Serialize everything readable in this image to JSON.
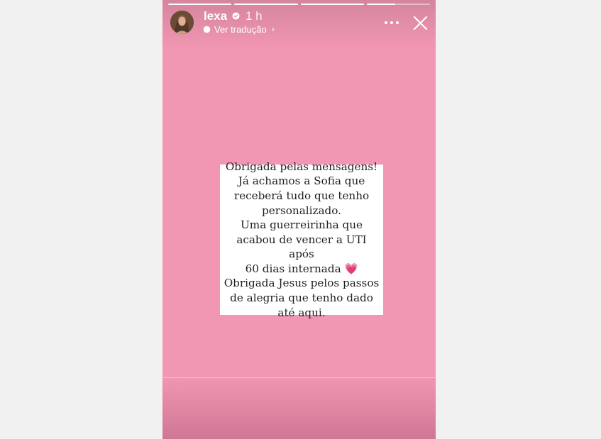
{
  "story": {
    "background_color": "#f297b3",
    "progress": [
      1,
      1,
      1,
      0.45
    ],
    "header": {
      "username": "lexa",
      "verified_icon": "verified-badge-icon",
      "time_ago": "1 h",
      "translate_label": "Ver tradução",
      "translate_chevron": "›",
      "more_icon": "more-horizontal-icon",
      "close_icon": "close-icon"
    },
    "card": {
      "lines": [
        "Obrigada pelas mensagens!",
        "Já achamos a Sofia que",
        "receberá tudo que tenho",
        "personalizado.",
        "Uma guerreirinha que",
        "acabou de vencer a UTI após",
        "60 dias internada",
        "Obrigada Jesus pelos passos",
        "de alegria que tenho dado",
        "até aqui."
      ],
      "heart_emoji": "💗"
    }
  }
}
